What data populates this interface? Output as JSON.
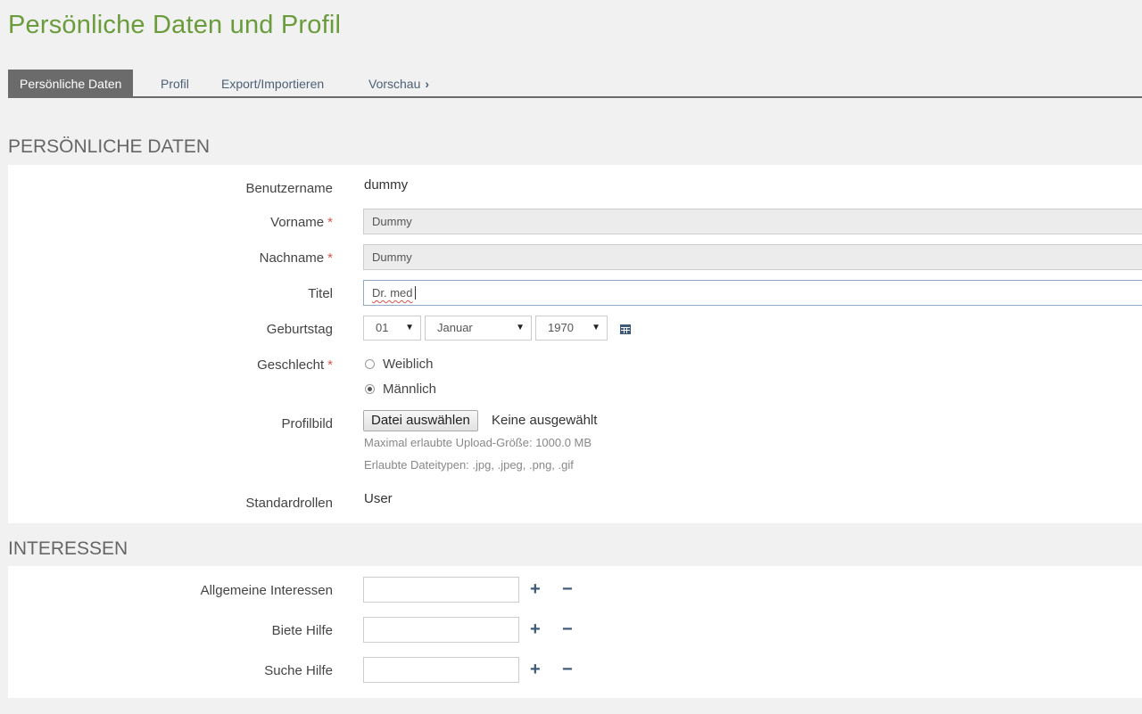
{
  "page": {
    "title": "Persönliche Daten und Profil"
  },
  "tabs": [
    {
      "label": "Persönliche Daten",
      "active": true
    },
    {
      "label": "Profil"
    },
    {
      "label": "Export/Importieren"
    },
    {
      "label": "Vorschau"
    }
  ],
  "personal": {
    "heading": "PERSÖNLICHE DATEN",
    "username_label": "Benutzername",
    "username_value": "dummy",
    "firstname_label": "Vorname",
    "firstname_value": "Dummy",
    "lastname_label": "Nachname",
    "lastname_value": "Dummy",
    "title_label": "Titel",
    "title_value": "Dr. med",
    "birthday_label": "Geburtstag",
    "birthday_day": "01",
    "birthday_month": "Januar",
    "birthday_year": "1970",
    "gender_label": "Geschlecht",
    "gender_female": "Weiblich",
    "gender_male": "Männlich",
    "gender_selected": "Männlich",
    "picture_label": "Profilbild",
    "file_button": "Datei auswählen",
    "file_status": "Keine ausgewählt",
    "upload_max": "Maximal erlaubte Upload-Größe: 1000.0 MB",
    "allowed_types": "Erlaubte Dateitypen: .jpg, .jpeg, .png, .gif",
    "roles_label": "Standardrollen",
    "roles_value": "User",
    "required_marker": "*"
  },
  "interests": {
    "heading": "INTERESSEN",
    "general_label": "Allgemeine Interessen",
    "offer_help_label": "Biete Hilfe",
    "seek_help_label": "Suche Hilfe",
    "add_symbol": "+",
    "remove_symbol": "−"
  },
  "colors": {
    "title_green": "#6a9c3c",
    "tab_active_bg": "#6b6b6b",
    "link_blue": "#4c6175",
    "required_red": "#d9534f"
  },
  "icons": {
    "tab_next": "chevron-right-icon",
    "calendar": "calendar-icon",
    "dropdown": "caret-down-icon"
  }
}
